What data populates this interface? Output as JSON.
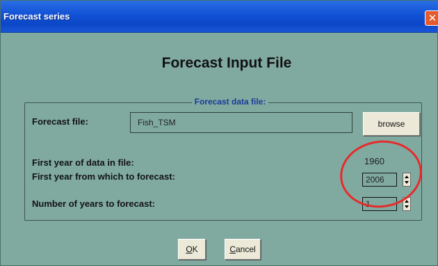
{
  "window": {
    "title": "Forecast series"
  },
  "heading": "Forecast Input File",
  "group": {
    "legend": "Forecast data file:"
  },
  "forecast_file": {
    "label": "Forecast file:",
    "value": "Fish_TSM"
  },
  "browse_label": "browse",
  "first_year_data": {
    "label": "First year of data in file:",
    "value": "1960"
  },
  "first_year_forecast": {
    "label": "First year from which to forecast:",
    "value": "2006"
  },
  "num_years": {
    "label": "Number of years to forecast:",
    "value": "1"
  },
  "buttons": {
    "ok_underline": "O",
    "ok_rest": "K",
    "cancel_underline": "C",
    "cancel_rest": "ancel"
  },
  "colors": {
    "background": "#80aaa0",
    "annotation": "#e62b2b",
    "titlebar": "#1454d8"
  }
}
